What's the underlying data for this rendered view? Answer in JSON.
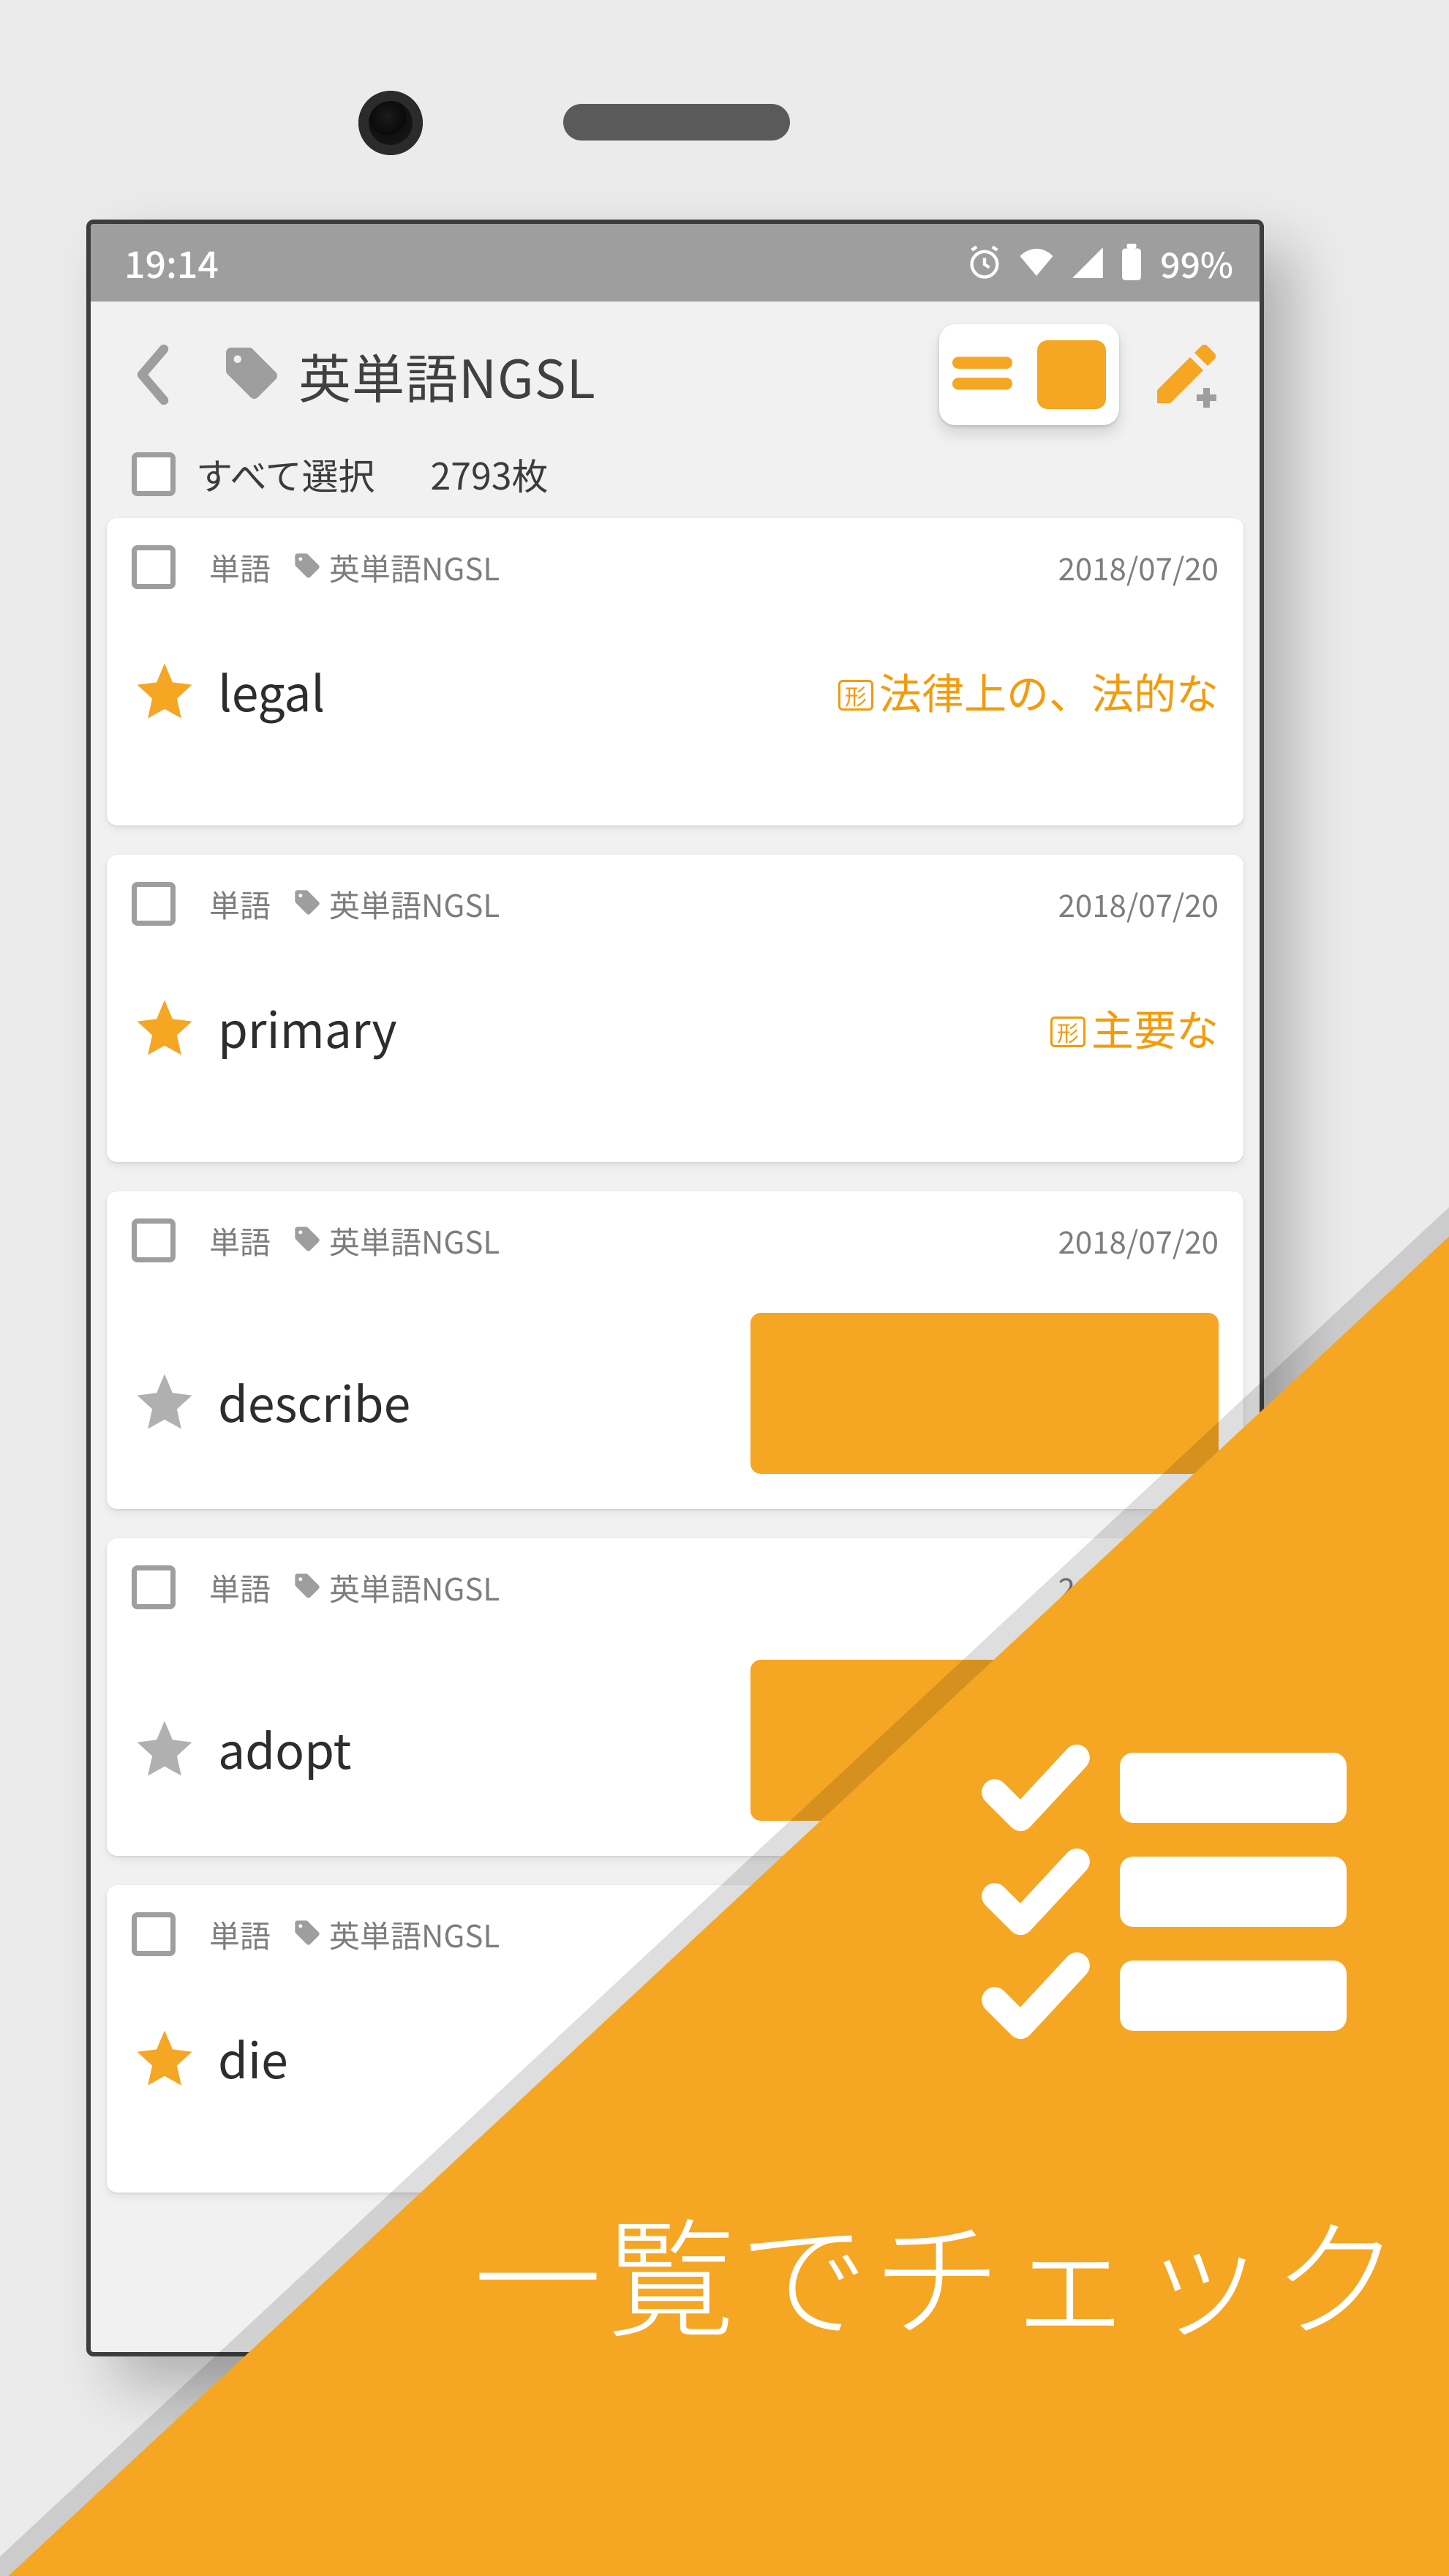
{
  "statusbar": {
    "time": "19:14",
    "battery_pct": "99%"
  },
  "header": {
    "title": "英単語NGSL"
  },
  "selectall": {
    "label": "すべて選択",
    "count": "2793枚"
  },
  "card_meta": {
    "category": "単語",
    "tag": "英単語NGSL",
    "date": "2018/07/20"
  },
  "cards": [
    {
      "word": "legal",
      "pos": "形",
      "meaning": "法律上の、法的な",
      "starred": true,
      "hidden_meaning": false
    },
    {
      "word": "primary",
      "pos": "形",
      "meaning": "主要な",
      "starred": true,
      "hidden_meaning": false
    },
    {
      "word": "describe",
      "pos": "",
      "meaning": "",
      "starred": false,
      "hidden_meaning": true
    },
    {
      "word": "adopt",
      "pos": "",
      "meaning": "",
      "starred": false,
      "hidden_meaning": true
    },
    {
      "word": "die",
      "pos": "",
      "meaning": "",
      "starred": true,
      "hidden_meaning": false
    }
  ],
  "overlay": {
    "caption": "一覧でチェック"
  }
}
